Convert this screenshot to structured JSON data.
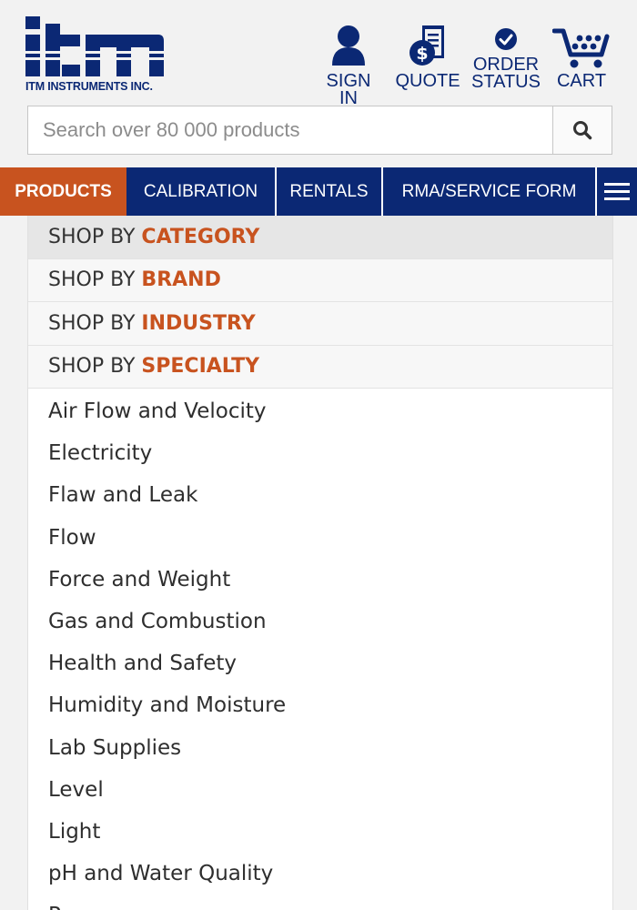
{
  "header": {
    "logo_company": "ITM INSTRUMENTS INC.",
    "links": {
      "sign_in": "SIGN IN",
      "quote": "QUOTE",
      "order_line1": "ORDER",
      "order_line2": "STATUS",
      "cart": "CART"
    }
  },
  "search": {
    "placeholder": "Search over 80 000 products",
    "icon": "search-icon"
  },
  "nav": {
    "products": "PRODUCTS",
    "calibration": "CALIBRATION",
    "rentals": "RENTALS",
    "rma": "RMA/SERVICE FORM",
    "menu_icon": "hamburger-menu-icon"
  },
  "shop_by": [
    {
      "prefix": "SHOP BY",
      "accent": "CATEGORY"
    },
    {
      "prefix": "SHOP BY",
      "accent": "BRAND"
    },
    {
      "prefix": "SHOP BY",
      "accent": "INDUSTRY"
    },
    {
      "prefix": "SHOP BY",
      "accent": "SPECIALTY"
    }
  ],
  "categories": [
    "Air Flow and Velocity",
    "Electricity",
    "Flaw and Leak",
    "Flow",
    "Force and Weight",
    "Gas and Combustion",
    "Health and Safety",
    "Humidity and Moisture",
    "Lab Supplies",
    "Level",
    "Light",
    "pH and Water Quality",
    "Pressure"
  ],
  "colors": {
    "brand_navy": "#0b2874",
    "accent_orange": "#c8531f"
  }
}
